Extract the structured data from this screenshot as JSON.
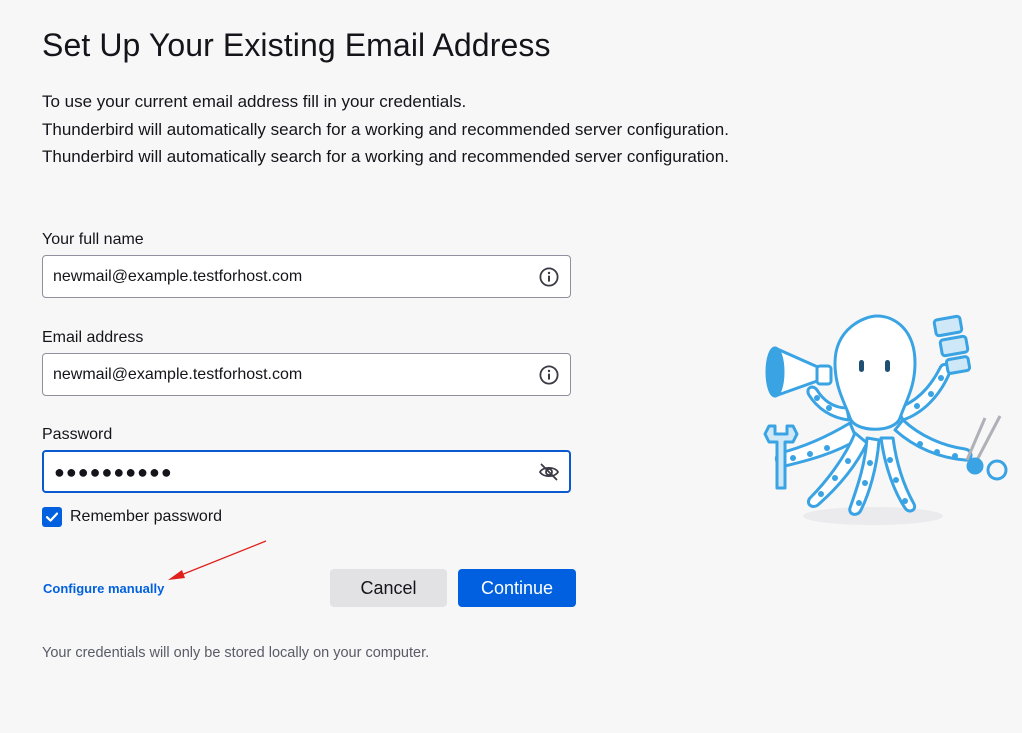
{
  "page": {
    "title": "Set Up Your Existing Email Address",
    "description_lines": [
      "To use your current email address fill in your credentials.",
      "Thunderbird will automatically search for a working and recommended server configuration.",
      "Thunderbird will automatically search for a working and recommended server configuration."
    ]
  },
  "form": {
    "full_name": {
      "label": "Your full name",
      "value": "newmail@example.testforhost.com",
      "icon": "info-icon"
    },
    "email": {
      "label": "Email address",
      "value": "newmail@example.testforhost.com",
      "icon": "info-icon"
    },
    "password": {
      "label": "Password",
      "masked_value": "●●●●●●●●●●",
      "icon": "eye-slash-icon"
    },
    "remember": {
      "label": "Remember password",
      "checked": true
    }
  },
  "actions": {
    "configure_manually": "Configure manually",
    "cancel": "Cancel",
    "continue": "Continue"
  },
  "footer": {
    "note": "Your credentials will only be stored locally on your computer."
  },
  "colors": {
    "accent": "#0060df",
    "focus_border": "#0b59cf",
    "annotation_arrow": "#e0201b",
    "mascot_blue": "#3aa3e3"
  }
}
